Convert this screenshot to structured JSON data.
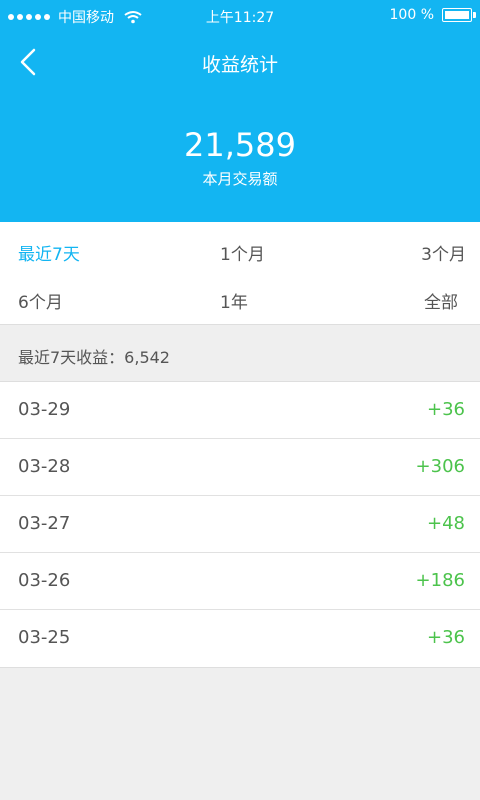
{
  "statusbar": {
    "carrier": "中国移动",
    "time": "上午11:27",
    "battery": "100 %"
  },
  "navbar": {
    "title": "收益统计"
  },
  "summary": {
    "value": "21,589",
    "label": "本月交易额"
  },
  "filters": [
    {
      "label": "最近7天",
      "active": true
    },
    {
      "label": "1个月",
      "active": false
    },
    {
      "label": "3个月",
      "active": false
    },
    {
      "label": "6个月",
      "active": false
    },
    {
      "label": "1年",
      "active": false
    },
    {
      "label": "全部",
      "active": false
    }
  ],
  "period_summary": "最近7天收益：6,542",
  "records": [
    {
      "date": "03-29",
      "amount": "+36"
    },
    {
      "date": "03-28",
      "amount": "+306"
    },
    {
      "date": "03-27",
      "amount": "+48"
    },
    {
      "date": "03-26",
      "amount": "+186"
    },
    {
      "date": "03-25",
      "amount": "+36"
    }
  ],
  "colors": {
    "brand": "#13b5f2",
    "positive": "#4cc34c"
  }
}
